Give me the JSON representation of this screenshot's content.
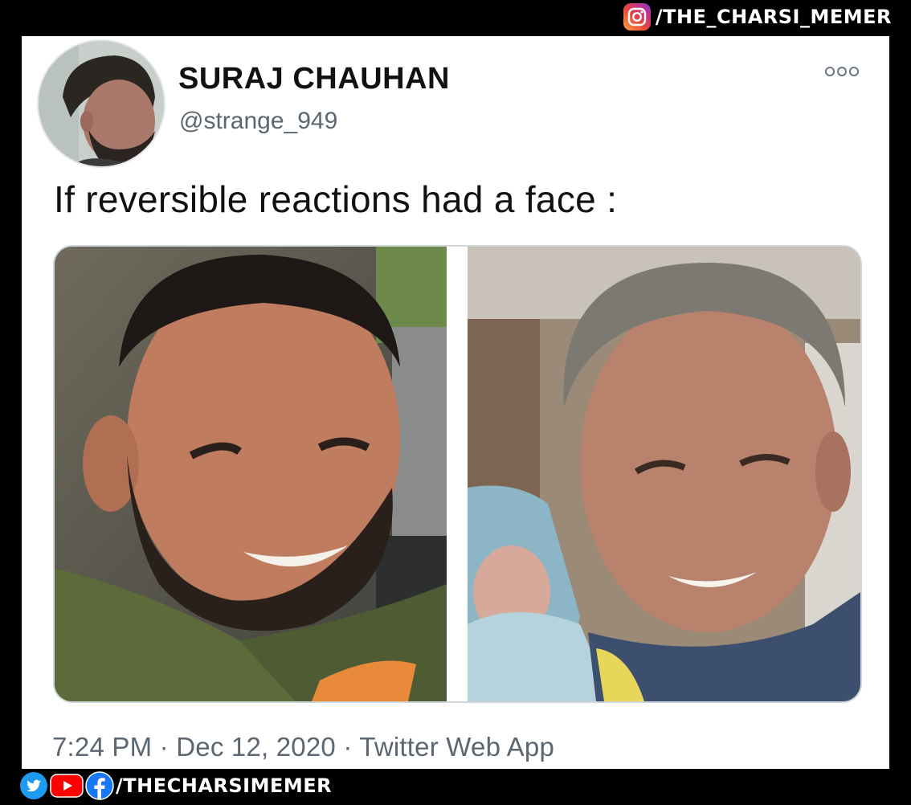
{
  "watermark_top": {
    "icon": "instagram-icon",
    "handle": "/THE_CHARSI_MEMER"
  },
  "tweet": {
    "display_name": "SURAJ CHAUHAN",
    "handle": "@strange_949",
    "text": "If reversible reactions had a face :",
    "meta": {
      "time": "7:24 PM",
      "date": "Dec 12, 2020",
      "source": "Twitter Web App",
      "separator": "·"
    },
    "more_icon": "more-options-icon"
  },
  "watermark_bottom": {
    "icons": [
      "twitter-icon",
      "youtube-icon",
      "facebook-icon"
    ],
    "handle": "/THECHARSIMEMER"
  },
  "colors": {
    "text": "#111111",
    "secondary_text": "#5b6670",
    "card_bg": "#ffffff",
    "frame_bg": "#000000",
    "twitter_blue": "#1d9bf0",
    "youtube_red": "#ff0000",
    "facebook_blue": "#1877f2"
  }
}
